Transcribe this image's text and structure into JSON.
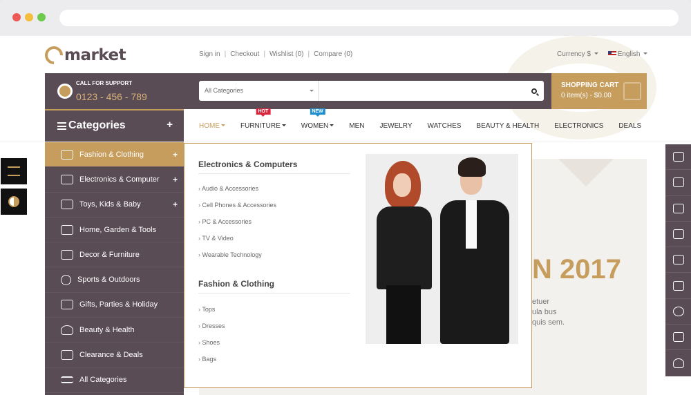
{
  "browser": {
    "url": ""
  },
  "logo": {
    "text": "market"
  },
  "top_links": {
    "signin": "Sign in",
    "checkout": "Checkout",
    "wishlist": "Wishlist (0)",
    "compare": "Compare (0)",
    "sep": "|"
  },
  "top_right": {
    "currency": "Currency $",
    "language": "English"
  },
  "support": {
    "title": "CALL FOR SUPPORT",
    "phone": "0123 - 456 - 789"
  },
  "search": {
    "category": "All Categories",
    "placeholder": ""
  },
  "cart": {
    "title": "SHOPPING CART",
    "info": "0 item(s) - $0.00"
  },
  "categories": {
    "title": "Categories",
    "plus": "+",
    "items": [
      {
        "label": "Fashion & Clothing",
        "icon": "shirt-icon",
        "has_sub": true,
        "active": true
      },
      {
        "label": "Electronics & Computer",
        "icon": "computer-icon",
        "has_sub": true
      },
      {
        "label": "Toys, Kids & Baby",
        "icon": "baby-icon",
        "has_sub": true
      },
      {
        "label": "Home, Garden & Tools",
        "icon": "roller-icon",
        "has_sub": false
      },
      {
        "label": "Decor & Furniture",
        "icon": "sofa-icon",
        "has_sub": false
      },
      {
        "label": "Sports & Outdoors",
        "icon": "ball-icon",
        "has_sub": false
      },
      {
        "label": "Gifts, Parties & Holiday",
        "icon": "gift-icon",
        "has_sub": false
      },
      {
        "label": "Beauty & Health",
        "icon": "heart-icon",
        "has_sub": false
      },
      {
        "label": "Clearance & Deals",
        "icon": "tag-icon",
        "has_sub": false
      },
      {
        "label": "All Categories",
        "icon": "list-icon",
        "has_sub": false
      }
    ]
  },
  "nav": {
    "items": [
      {
        "label": "HOME",
        "caret": true,
        "active": true
      },
      {
        "label": "FURNITURE",
        "caret": true,
        "badge": "HOT"
      },
      {
        "label": "WOMEN",
        "caret": true,
        "badge": "NEW"
      },
      {
        "label": "MEN"
      },
      {
        "label": "JEWELRY"
      },
      {
        "label": "WATCHES"
      },
      {
        "label": "BEAUTY & HEALTH"
      },
      {
        "label": "ELECTRONICS"
      },
      {
        "label": "DEALS"
      }
    ]
  },
  "mega": {
    "group1": {
      "title": "Electronics & Computers",
      "links": [
        "Audio & Accessories",
        "Cell Phones & Accessories",
        "PC & Accessories",
        "TV & Video",
        "Wearable Technology"
      ]
    },
    "group2": {
      "title": "Fashion & Clothing",
      "links": [
        "Tops",
        "Dresses",
        "Shoes",
        "Bags"
      ]
    }
  },
  "banner": {
    "year": "N 2017",
    "text_lines": [
      "etuer",
      "ula bus",
      "quis sem."
    ]
  },
  "colors": {
    "brand": "#5a4c54",
    "accent": "#c69d5c",
    "hot": "#d9253d",
    "new": "#1e90d0"
  }
}
